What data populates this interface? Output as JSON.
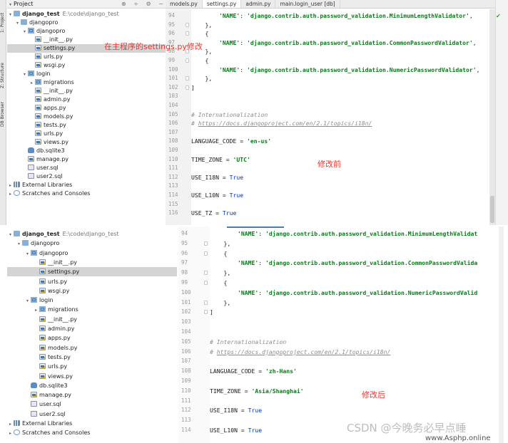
{
  "top": {
    "tabs": [
      "models.py",
      "settings.py",
      "admin.py",
      "main.login_user [db]"
    ],
    "tree": {
      "project_label": "Project",
      "rows": [
        {
          "label": "django_test",
          "path": "E:\\code\\django_test",
          "icon": "folder",
          "depth": 0,
          "expanded": true,
          "bold": true
        },
        {
          "label": "djangopro",
          "icon": "folder",
          "depth": 1,
          "expanded": true
        },
        {
          "label": "djangopro",
          "icon": "package",
          "depth": 2,
          "expanded": true
        },
        {
          "label": "__init__.py",
          "icon": "python-file",
          "depth": 3
        },
        {
          "label": "settings.py",
          "icon": "python-file",
          "depth": 3,
          "selected": true
        },
        {
          "label": "urls.py",
          "icon": "python-file",
          "depth": 3
        },
        {
          "label": "wsgi.py",
          "icon": "python-file",
          "depth": 3
        },
        {
          "label": "login",
          "icon": "package",
          "depth": 2,
          "expanded": true
        },
        {
          "label": "migrations",
          "icon": "package",
          "depth": 3,
          "collapsed": true
        },
        {
          "label": "__init__.py",
          "icon": "python-file",
          "depth": 3
        },
        {
          "label": "admin.py",
          "icon": "python-file",
          "depth": 3
        },
        {
          "label": "apps.py",
          "icon": "python-file",
          "depth": 3
        },
        {
          "label": "models.py",
          "icon": "python-file",
          "depth": 3
        },
        {
          "label": "tests.py",
          "icon": "python-file",
          "depth": 3
        },
        {
          "label": "urls.py",
          "icon": "python-file",
          "depth": 3
        },
        {
          "label": "views.py",
          "icon": "python-file",
          "depth": 3
        },
        {
          "label": "db.sqlite3",
          "icon": "database",
          "depth": 2
        },
        {
          "label": "manage.py",
          "icon": "python-file",
          "depth": 2
        },
        {
          "label": "user.sql",
          "icon": "sql-file",
          "depth": 2
        },
        {
          "label": "user2.sql",
          "icon": "sql-file",
          "depth": 2
        },
        {
          "label": "External Libraries",
          "icon": "library",
          "depth": 0,
          "collapsed": true
        },
        {
          "label": "Scratches and Consoles",
          "icon": "scratch",
          "depth": 0,
          "collapsed": true
        }
      ]
    },
    "line_numbers": [
      "94",
      "95",
      "96",
      "97",
      "98",
      "99",
      "100",
      "101",
      "102",
      "103",
      "104",
      "105",
      "106",
      "107",
      "108",
      "109",
      "110",
      "111",
      "112",
      "113",
      "114",
      "115",
      "116"
    ],
    "code": [
      "        'NAME': 'django.contrib.auth.password_validation.MinimumLengthValidator',",
      "    },",
      "    {",
      "        'NAME': 'django.contrib.auth.password_validation.CommonPasswordValidator',",
      "    },",
      "    {",
      "        'NAME': 'django.contrib.auth.password_validation.NumericPasswordValidator',",
      "    },",
      "]",
      "",
      "",
      "# Internationalization",
      "# https://docs.djangoproject.com/en/2.1/topics/i18n/",
      "",
      "LANGUAGE_CODE = 'en-us'",
      "",
      "TIME_ZONE = 'UTC'",
      "",
      "USE_I18N = True",
      "",
      "USE_L10N = True",
      "",
      "USE_TZ = True"
    ],
    "annotation_settings": "在主程序的settings.py修改",
    "annotation_before": "修改前"
  },
  "bottom": {
    "tree": {
      "rows": [
        {
          "label": "django_test",
          "path": "E:\\code\\django_test",
          "icon": "folder",
          "depth": 0,
          "expanded": true,
          "bold": true
        },
        {
          "label": "djangopro",
          "icon": "folder",
          "depth": 1,
          "expanded": true
        },
        {
          "label": "djangopro",
          "icon": "package",
          "depth": 2,
          "expanded": true
        },
        {
          "label": "__init__.py",
          "icon": "python-file",
          "depth": 3
        },
        {
          "label": "settings.py",
          "icon": "python-file",
          "depth": 3,
          "selected": true
        },
        {
          "label": "urls.py",
          "icon": "python-file",
          "depth": 3
        },
        {
          "label": "wsgi.py",
          "icon": "python-file",
          "depth": 3
        },
        {
          "label": "login",
          "icon": "package",
          "depth": 2,
          "expanded": true
        },
        {
          "label": "migrations",
          "icon": "package",
          "depth": 3,
          "collapsed": true
        },
        {
          "label": "__init__.py",
          "icon": "python-file",
          "depth": 3
        },
        {
          "label": "admin.py",
          "icon": "python-file",
          "depth": 3
        },
        {
          "label": "apps.py",
          "icon": "python-file",
          "depth": 3
        },
        {
          "label": "models.py",
          "icon": "python-file",
          "depth": 3
        },
        {
          "label": "tests.py",
          "icon": "python-file",
          "depth": 3
        },
        {
          "label": "urls.py",
          "icon": "python-file",
          "depth": 3
        },
        {
          "label": "views.py",
          "icon": "python-file",
          "depth": 3
        },
        {
          "label": "db.sqlite3",
          "icon": "database",
          "depth": 2
        },
        {
          "label": "manage.py",
          "icon": "python-file",
          "depth": 2
        },
        {
          "label": "user.sql",
          "icon": "sql-file",
          "depth": 2
        },
        {
          "label": "user2.sql",
          "icon": "sql-file",
          "depth": 2
        },
        {
          "label": "External Libraries",
          "icon": "library",
          "depth": 0,
          "collapsed": true
        },
        {
          "label": "Scratches and Consoles",
          "icon": "scratch",
          "depth": 0,
          "collapsed": true
        }
      ]
    },
    "line_numbers": [
      "94",
      "95",
      "96",
      "97",
      "98",
      "99",
      "100",
      "101",
      "102",
      "103",
      "104",
      "105",
      "106",
      "107",
      "108",
      "109",
      "110",
      "111",
      "112",
      "113",
      "114"
    ],
    "code": [
      "        'NAME': 'django.contrib.auth.password_validation.MinimumLengthValidat",
      "    },",
      "    {",
      "        'NAME': 'django.contrib.auth.password_validation.CommonPasswordValida",
      "    },",
      "    {",
      "        'NAME': 'django.contrib.auth.password_validation.NumericPasswordValid",
      "    },",
      "]",
      "",
      "",
      "# Internationalization",
      "# https://docs.djangoproject.com/en/2.1/topics/i18n/",
      "",
      "LANGUAGE_CODE = 'zh-Hans'",
      "",
      "TIME_ZONE = 'Asia/Shanghai'",
      "",
      "USE_I18N = True",
      "",
      "USE_L10N = True"
    ],
    "annotation_after": "修改后"
  },
  "sidebar_labels": [
    "1: Project",
    "Z: Structure",
    "DB Browser"
  ],
  "watermark": {
    "main": "CSDN @今晚务必早点睡",
    "url": "www.Asphp.online"
  },
  "colors": {
    "annotation": "#e8382f",
    "string": "#067d17",
    "keyword": "#0033b3",
    "comment": "#8c8c8c",
    "selection": "#d4d4d4"
  }
}
